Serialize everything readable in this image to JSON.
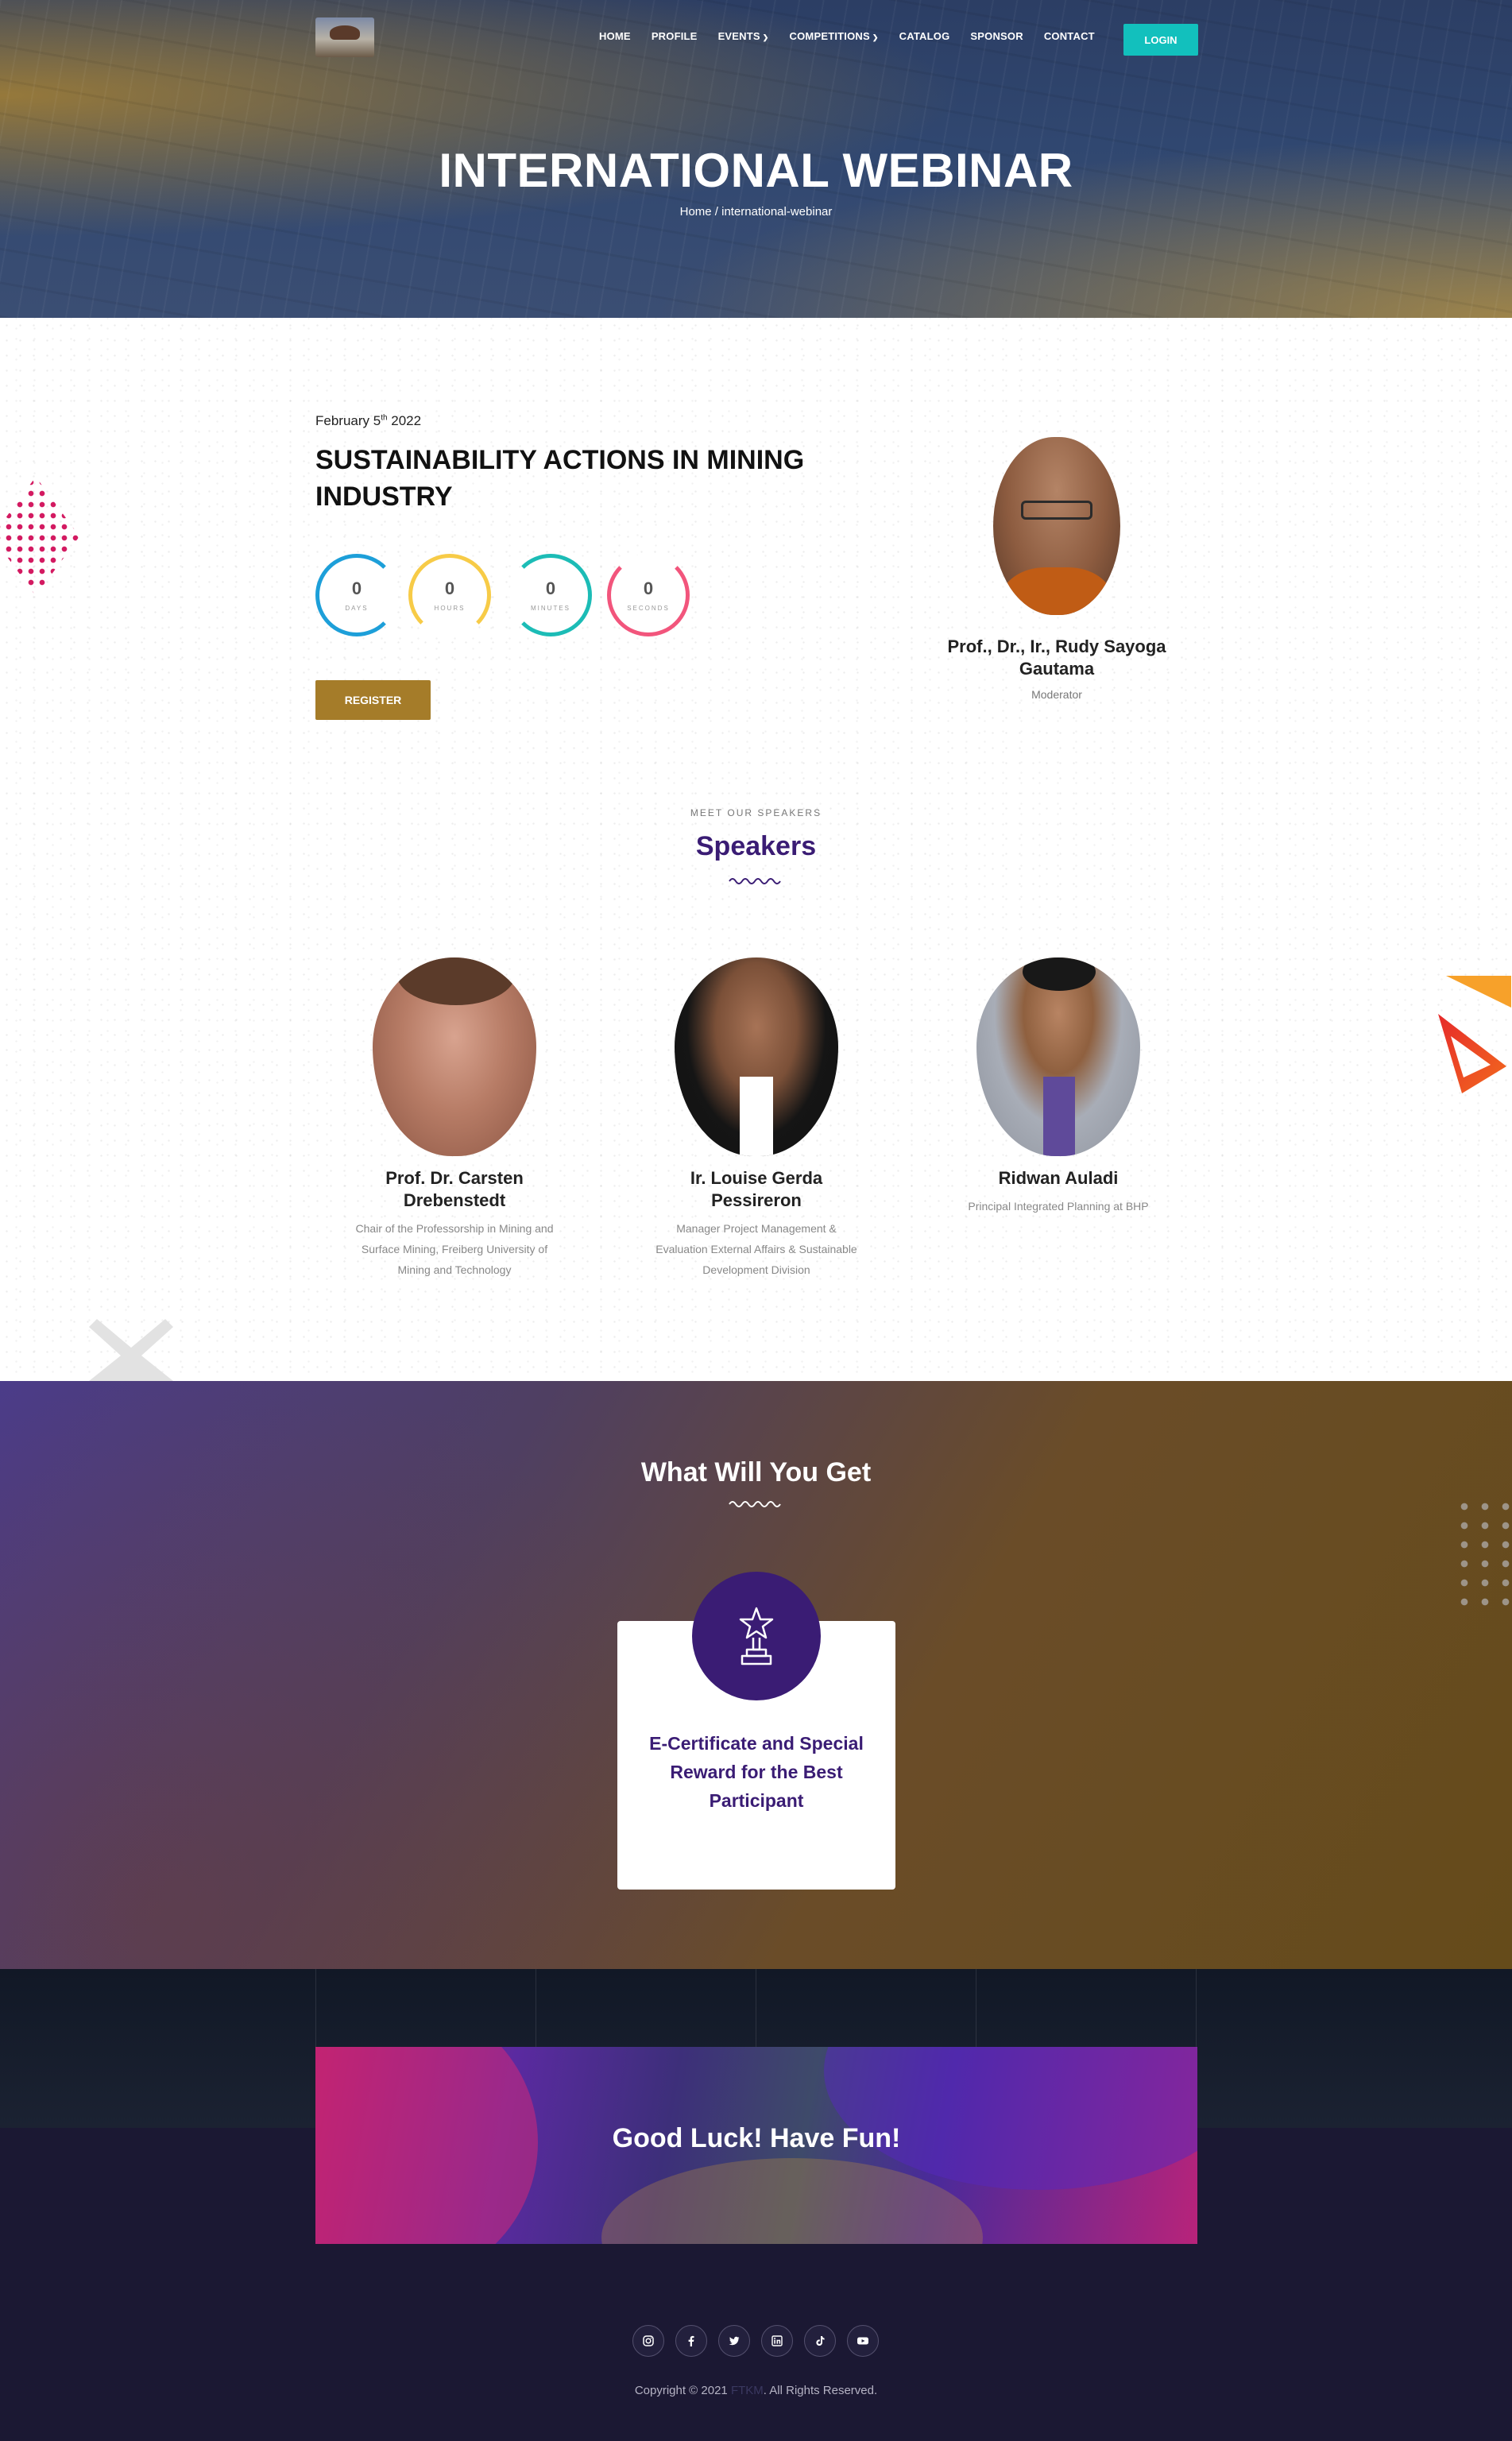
{
  "header": {
    "nav": [
      {
        "label": "HOME",
        "dropdown": false
      },
      {
        "label": "PROFILE",
        "dropdown": false
      },
      {
        "label": "EVENTS",
        "dropdown": true
      },
      {
        "label": "COMPETITIONS",
        "dropdown": true
      },
      {
        "label": "CATALOG",
        "dropdown": false
      },
      {
        "label": "SPONSOR",
        "dropdown": false
      },
      {
        "label": "CONTACT",
        "dropdown": false
      }
    ],
    "login_label": "LOGIN"
  },
  "hero": {
    "title": "INTERNATIONAL WEBINAR",
    "breadcrumb": "Home / international-webinar"
  },
  "event": {
    "date_month": "February 5",
    "date_suffix": "th",
    "date_year": " 2022",
    "title": "SUSTAINABILITY ACTIONS IN MINING INDUSTRY",
    "countdown": [
      {
        "value": "0",
        "label": "DAYS"
      },
      {
        "value": "0",
        "label": "HOURS"
      },
      {
        "value": "0",
        "label": "MINUTES"
      },
      {
        "value": "0",
        "label": "SECONDS"
      }
    ],
    "register_label": "REGISTER"
  },
  "moderator": {
    "name": "Prof., Dr., Ir., Rudy Sayoga Gautama",
    "role": "Moderator"
  },
  "speakers_section": {
    "eyebrow": "MEET OUR SPEAKERS",
    "title": "Speakers",
    "speakers": [
      {
        "name": "Prof. Dr. Carsten Drebenstedt",
        "role": "Chair of the Professorship in Mining and Surface Mining, Freiberg University of Mining and Technology"
      },
      {
        "name": "Ir. Louise Gerda Pessireron",
        "role": "Manager Project Management & Evaluation External Affairs & Sustainable Development Division"
      },
      {
        "name": "Ridwan Auladi",
        "role": "Principal Integrated Planning at BHP"
      }
    ]
  },
  "benefits": {
    "title": "What Will You Get",
    "card_text": "E-Certificate and Special Reward for the Best Participant",
    "icon": "trophy-icon"
  },
  "banner": {
    "text": "Good Luck! Have Fun!"
  },
  "footer": {
    "socials": [
      "instagram-icon",
      "facebook-icon",
      "twitter-icon",
      "linkedin-icon",
      "tiktok-icon",
      "youtube-icon"
    ],
    "copyright_prefix": "Copyright © 2021",
    "brand": "FTKM",
    "copyright_suffix": ". All Rights Reserved."
  },
  "colors": {
    "accent_teal": "#12c0bd",
    "register_gold": "#a57c29",
    "purple": "#3a1c74"
  }
}
